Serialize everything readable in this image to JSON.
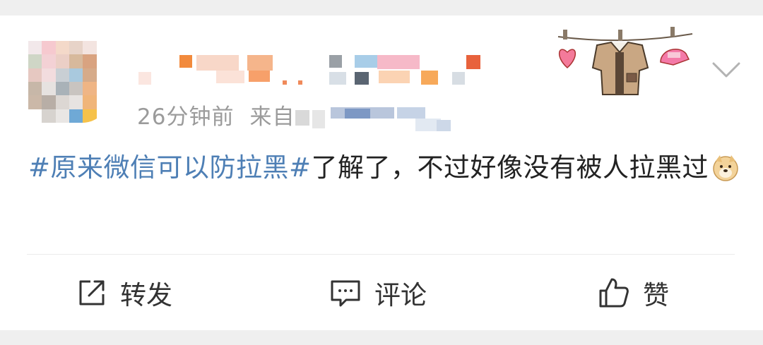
{
  "post": {
    "time": "26分钟前",
    "source_prefix": "来自",
    "topic": "#原来微信可以防拉黑#",
    "text": "了解了，不过好像没有被人拉黑过"
  },
  "actions": {
    "repost_label": "转发",
    "comment_label": "评论",
    "like_label": "赞"
  },
  "icons": {
    "repost": "share-icon",
    "comment": "comment-icon",
    "like": "thumbs-up-icon",
    "more": "chevron-down-icon",
    "emoji": "doge-emoji-icon"
  },
  "colors": {
    "topic": "#4e7fb5",
    "text": "#222222",
    "meta": "#9b9b9b",
    "background": "#efefef"
  }
}
